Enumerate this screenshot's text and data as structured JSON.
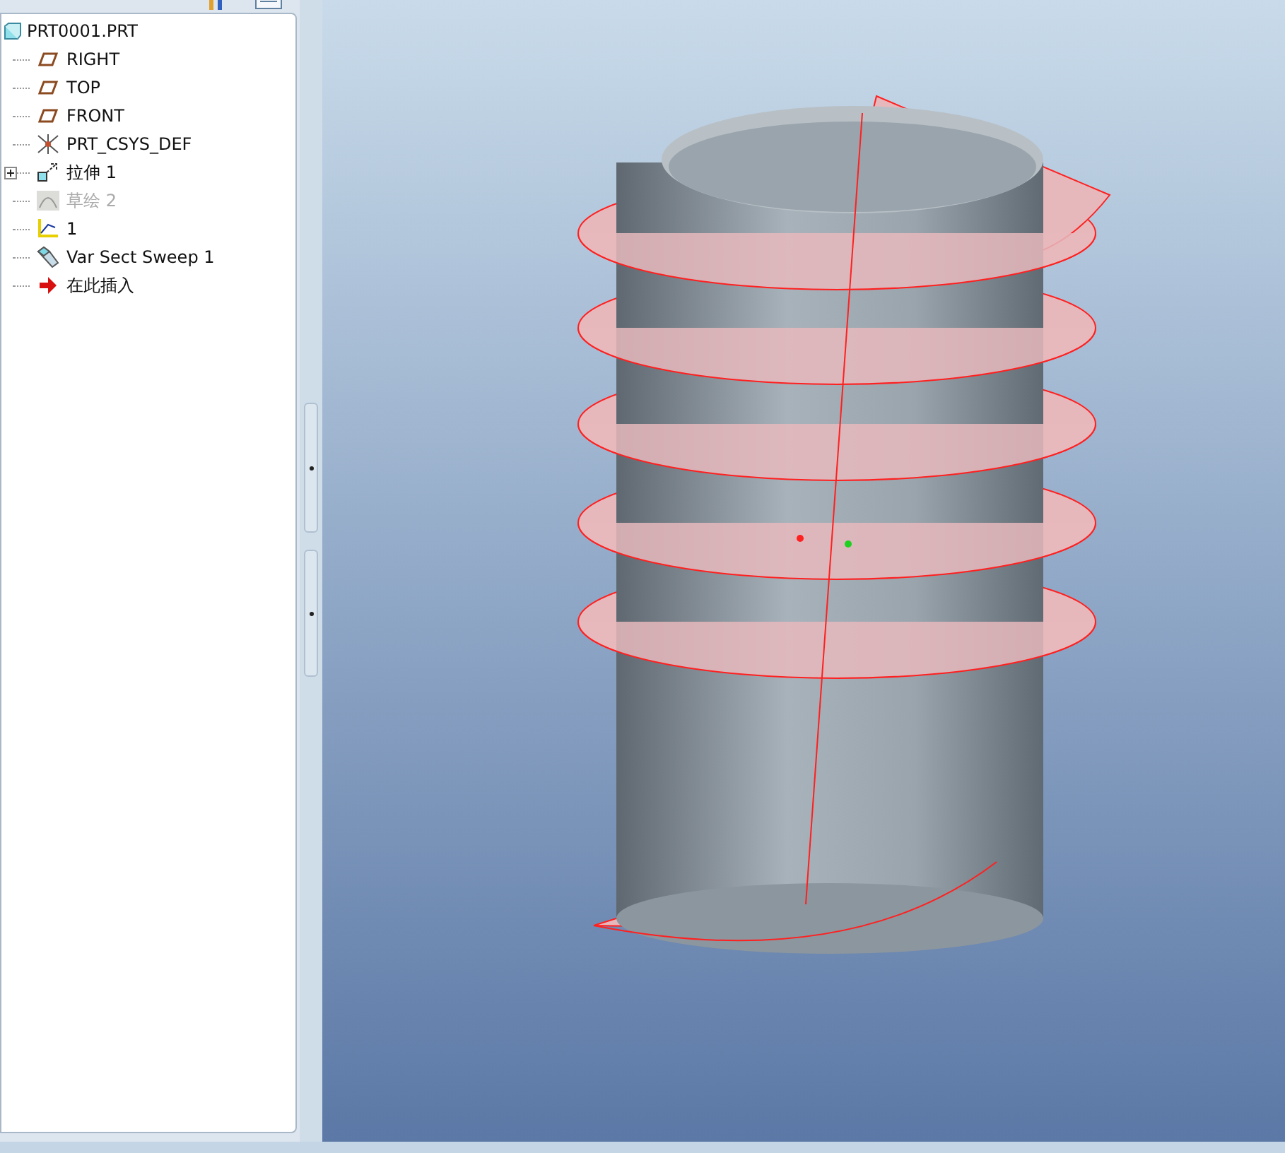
{
  "model_tree": {
    "root": {
      "label": "PRT0001.PRT",
      "kind": "part",
      "children": [
        {
          "label": "RIGHT",
          "kind": "datum_plane",
          "disabled": false
        },
        {
          "label": "TOP",
          "kind": "datum_plane",
          "disabled": false
        },
        {
          "label": "FRONT",
          "kind": "datum_plane",
          "disabled": false
        },
        {
          "label": "PRT_CSYS_DEF",
          "kind": "csys",
          "disabled": false
        },
        {
          "label": "拉伸 1",
          "kind": "extrude",
          "disabled": false,
          "expanded": false
        },
        {
          "label": "草绘 2",
          "kind": "sketch",
          "disabled": true
        },
        {
          "label": "1",
          "kind": "curve",
          "disabled": false
        },
        {
          "label": "Var Sect Sweep 1",
          "kind": "sweep",
          "disabled": false
        },
        {
          "label": "在此插入",
          "kind": "insert",
          "disabled": false
        }
      ]
    }
  }
}
